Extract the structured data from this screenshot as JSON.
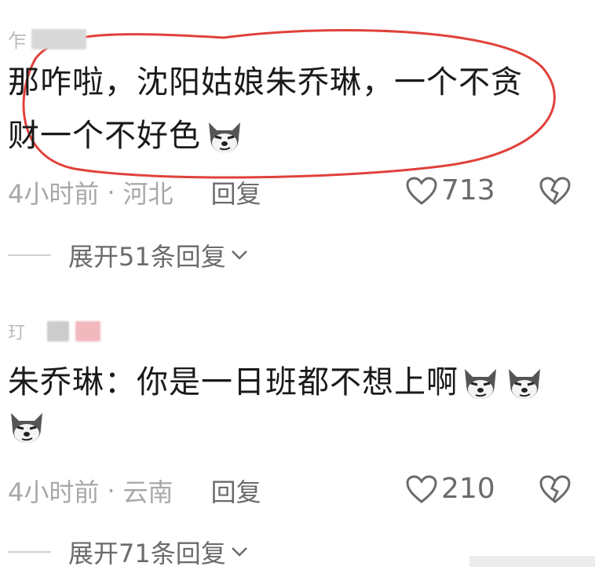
{
  "comments": [
    {
      "username_initial": "乍",
      "text_line1": "那咋啦，沈阳姑娘朱乔琳，一个不贪",
      "text_line2": "财一个不好色",
      "time": "4小时前",
      "location": "河北",
      "separator": "·",
      "reply_label": "回复",
      "likes": "713",
      "expand_label": "展开51条回复"
    },
    {
      "username_initial": "玎",
      "text_line1": "朱乔琳：你是一日班都不想上啊",
      "time": "4小时前",
      "location": "云南",
      "separator": "·",
      "reply_label": "回复",
      "likes": "210",
      "expand_label": "展开71条回复"
    }
  ],
  "icons": {
    "like": "heart-outline-icon",
    "dislike": "broken-heart-icon",
    "expand": "chevron-down-icon",
    "emoji": "husky-smirk-emoji"
  },
  "colors": {
    "annotation_circle": "#e0413b",
    "muted_text": "#a8a8a8",
    "secondary_text": "#6b6b6b",
    "primary_text": "#1a1a1a"
  }
}
